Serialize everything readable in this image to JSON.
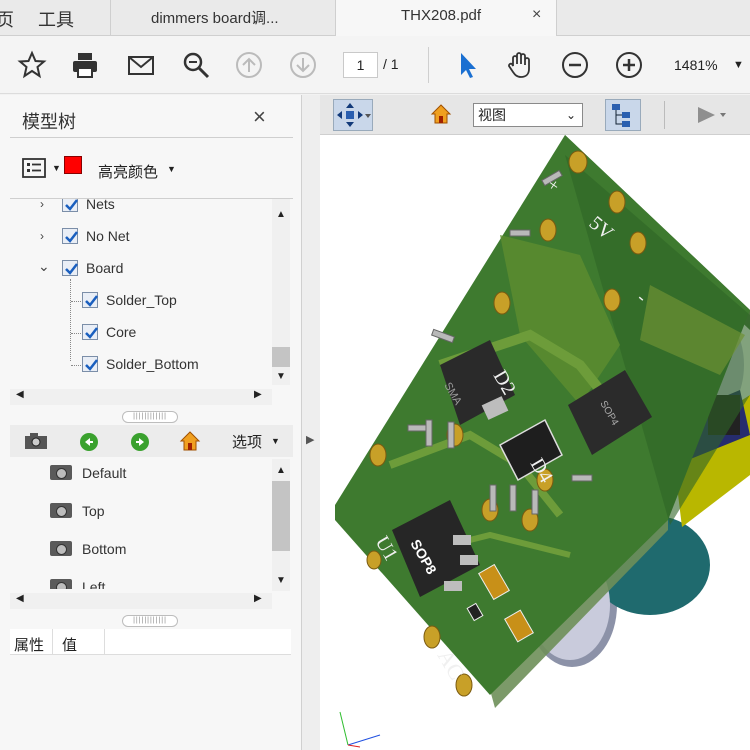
{
  "menu": {
    "item_partial": "页",
    "tools": "工具"
  },
  "tabs": [
    {
      "label": "dimmers board调..."
    },
    {
      "label": "THX208.pdf",
      "close": "×"
    }
  ],
  "toolbar": {
    "page_current": "1",
    "page_total": "/ 1",
    "zoom": "1481%",
    "icons": [
      "star-icon",
      "printer-icon",
      "mail-icon",
      "search-zoom-icon",
      "page-up-icon",
      "page-down-icon",
      "select-cursor-icon",
      "hand-icon",
      "zoom-out-icon",
      "zoom-in-icon"
    ]
  },
  "left_panel": {
    "title": "模型树",
    "close": "×",
    "highlight_label": "高亮颜色",
    "highlight_color": "#ff0000",
    "tree": [
      {
        "label": "Nets",
        "level": 1,
        "arrow": "›"
      },
      {
        "label": "No Net",
        "level": 1,
        "arrow": "›"
      },
      {
        "label": "Board",
        "level": 1,
        "arrow": "⌄"
      },
      {
        "label": "Solder_Top",
        "level": 2
      },
      {
        "label": "Core",
        "level": 2
      },
      {
        "label": "Solder_Bottom",
        "level": 2
      }
    ],
    "views_options": "选项",
    "views": [
      "Default",
      "Top",
      "Bottom",
      "Left"
    ],
    "properties": {
      "attr": "属性",
      "value": "值"
    }
  },
  "viewer": {
    "view_select": "视图",
    "pcb_labels": {
      "plus": "+",
      "v5": "5V",
      "minus": "-",
      "sma": "SMA",
      "d2": "D2",
      "sop4": "SOP4",
      "d4": "D4",
      "u1": "U1",
      "sop8": "SOP8",
      "ac": "AC"
    }
  }
}
